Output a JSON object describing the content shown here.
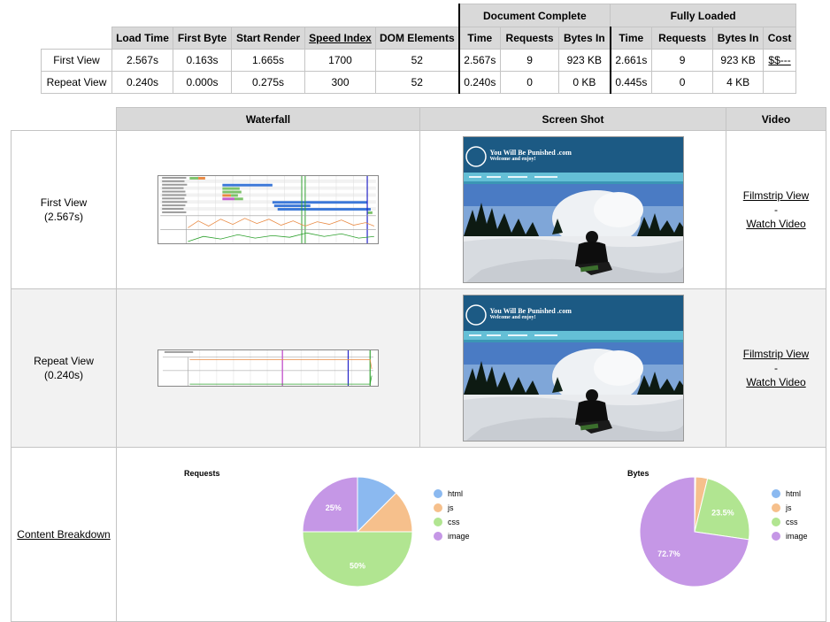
{
  "summary": {
    "group_headers": {
      "document_complete": "Document Complete",
      "fully_loaded": "Fully Loaded"
    },
    "columns": [
      "Load Time",
      "First Byte",
      "Start Render",
      "Speed Index",
      "DOM Elements",
      "Time",
      "Requests",
      "Bytes In",
      "Time",
      "Requests",
      "Bytes In",
      "Cost"
    ],
    "rows": [
      {
        "label": "First View",
        "cells": [
          "2.567s",
          "0.163s",
          "1.665s",
          "1700",
          "52",
          "2.567s",
          "9",
          "923 KB",
          "2.661s",
          "9",
          "923 KB",
          "$$---"
        ]
      },
      {
        "label": "Repeat View",
        "cells": [
          "0.240s",
          "0.000s",
          "0.275s",
          "300",
          "52",
          "0.240s",
          "0",
          "0 KB",
          "0.445s",
          "0",
          "4 KB",
          ""
        ]
      }
    ]
  },
  "results": {
    "headers": {
      "waterfall": "Waterfall",
      "screenshot": "Screen Shot",
      "video": "Video"
    },
    "views": [
      {
        "label": "First View",
        "time": "(2.567s)",
        "filmstrip": "Filmstrip View",
        "dash": "-",
        "watch": "Watch Video"
      },
      {
        "label": "Repeat View",
        "time": "(0.240s)",
        "filmstrip": "Filmstrip View",
        "dash": "-",
        "watch": "Watch Video"
      }
    ],
    "screenshot_text": {
      "title": "You Will Be Punished .com",
      "tagline": "Welcome and enjoy!"
    },
    "content_breakdown_label": "Content Breakdown"
  },
  "breakdown": {
    "legend": [
      "html",
      "js",
      "css",
      "image"
    ],
    "colors": {
      "html": "#8bb9f0",
      "js": "#f6c08c",
      "css": "#b1e591",
      "image": "#c597e6"
    }
  },
  "chart_data": [
    {
      "type": "pie",
      "title": "Requests",
      "categories": [
        "html",
        "js",
        "css",
        "image"
      ],
      "values": [
        12.5,
        12.5,
        50,
        25
      ],
      "data_labels": [
        "",
        "",
        "50%",
        "25%"
      ]
    },
    {
      "type": "pie",
      "title": "Bytes",
      "categories": [
        "html",
        "js",
        "css",
        "image"
      ],
      "values": [
        0.3,
        3.5,
        23.5,
        72.7
      ],
      "data_labels": [
        "",
        "",
        "23.5%",
        "72.7%"
      ]
    }
  ]
}
